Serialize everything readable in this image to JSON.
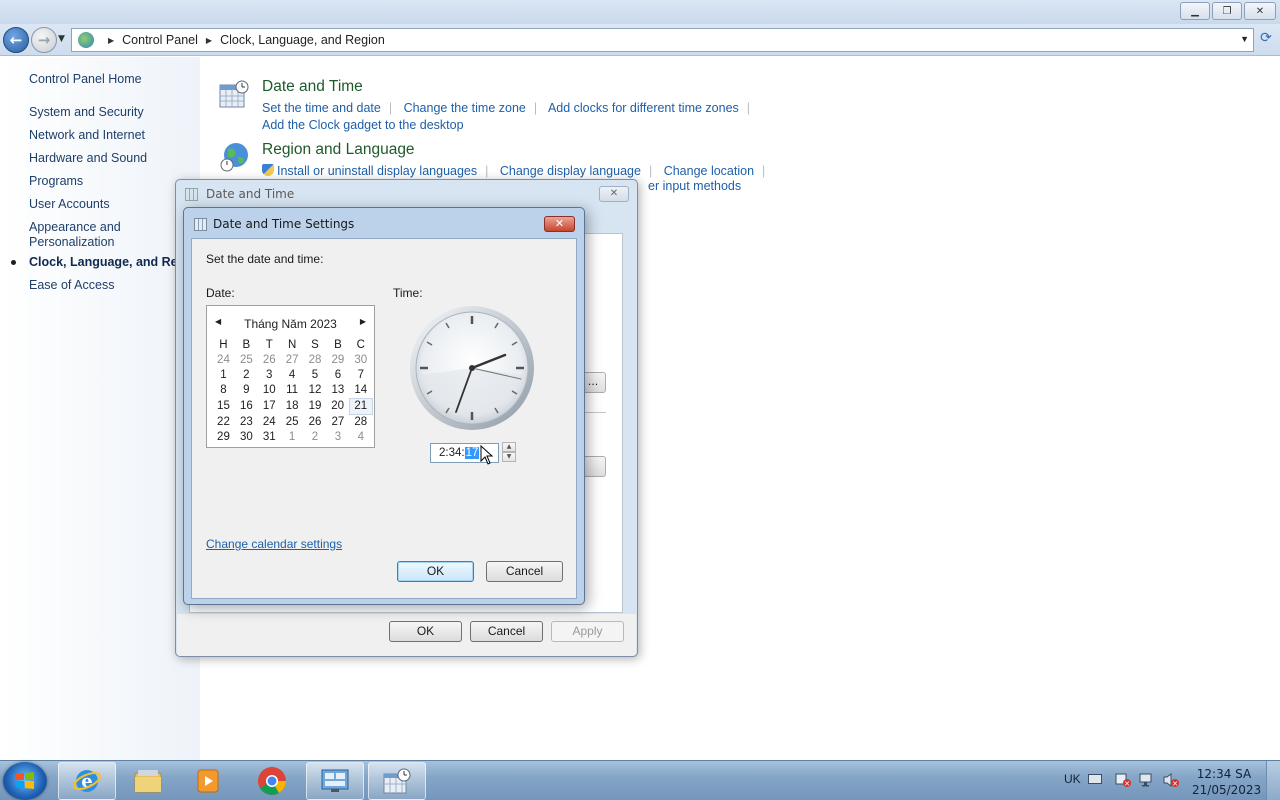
{
  "window": {
    "caption_buttons": [
      "minimize",
      "restore",
      "close"
    ]
  },
  "address": {
    "crumbs": [
      "Control Panel",
      "Clock, Language, and Region"
    ]
  },
  "leftnav": {
    "home": "Control Panel Home",
    "items": [
      "System and Security",
      "Network and Internet",
      "Hardware and Sound",
      "Programs",
      "User Accounts",
      "Appearance and Personalization",
      "Clock, Language, and Region",
      "Ease of Access"
    ],
    "current": "Clock, Language, and Region"
  },
  "categories": {
    "datetime": {
      "title": "Date and Time",
      "links": [
        "Set the time and date",
        "Change the time zone",
        "Add clocks for different time zones"
      ],
      "links2": [
        "Add the Clock gadget to the desktop"
      ]
    },
    "region": {
      "title": "Region and Language",
      "links": [
        "Install or uninstall display languages",
        "Change display language",
        "Change location"
      ],
      "partial": "er input methods"
    }
  },
  "dialog_back": {
    "title": "Date and Time",
    "ok": "OK",
    "cancel": "Cancel",
    "apply": "Apply",
    "ellipsis": "..."
  },
  "dialog_front": {
    "title": "Date and Time Settings",
    "instruction": "Set the date and time:",
    "date_label": "Date:",
    "time_label": "Time:",
    "calendar": {
      "month": "Tháng Năm 2023",
      "weekdays": [
        "H",
        "B",
        "T",
        "N",
        "S",
        "B",
        "C"
      ],
      "weeks": [
        [
          "24",
          "25",
          "26",
          "27",
          "28",
          "29",
          "30"
        ],
        [
          "1",
          "2",
          "3",
          "4",
          "5",
          "6",
          "7"
        ],
        [
          "8",
          "9",
          "10",
          "11",
          "12",
          "13",
          "14"
        ],
        [
          "15",
          "16",
          "17",
          "18",
          "19",
          "20",
          "21"
        ],
        [
          "22",
          "23",
          "24",
          "25",
          "26",
          "27",
          "28"
        ],
        [
          "29",
          "30",
          "31",
          "1",
          "2",
          "3",
          "4"
        ]
      ],
      "selected": "21"
    },
    "time_value_prefix": "2:34:",
    "time_value_seconds": "17",
    "change_calendar": "Change calendar settings",
    "ok": "OK",
    "cancel": "Cancel"
  },
  "taskbar": {
    "apps": [
      "internet-explorer",
      "file-explorer",
      "media-player",
      "chrome",
      "control-panel",
      "date-time"
    ],
    "language": "UK",
    "time": "12:34 SA",
    "date": "21/05/2023"
  }
}
